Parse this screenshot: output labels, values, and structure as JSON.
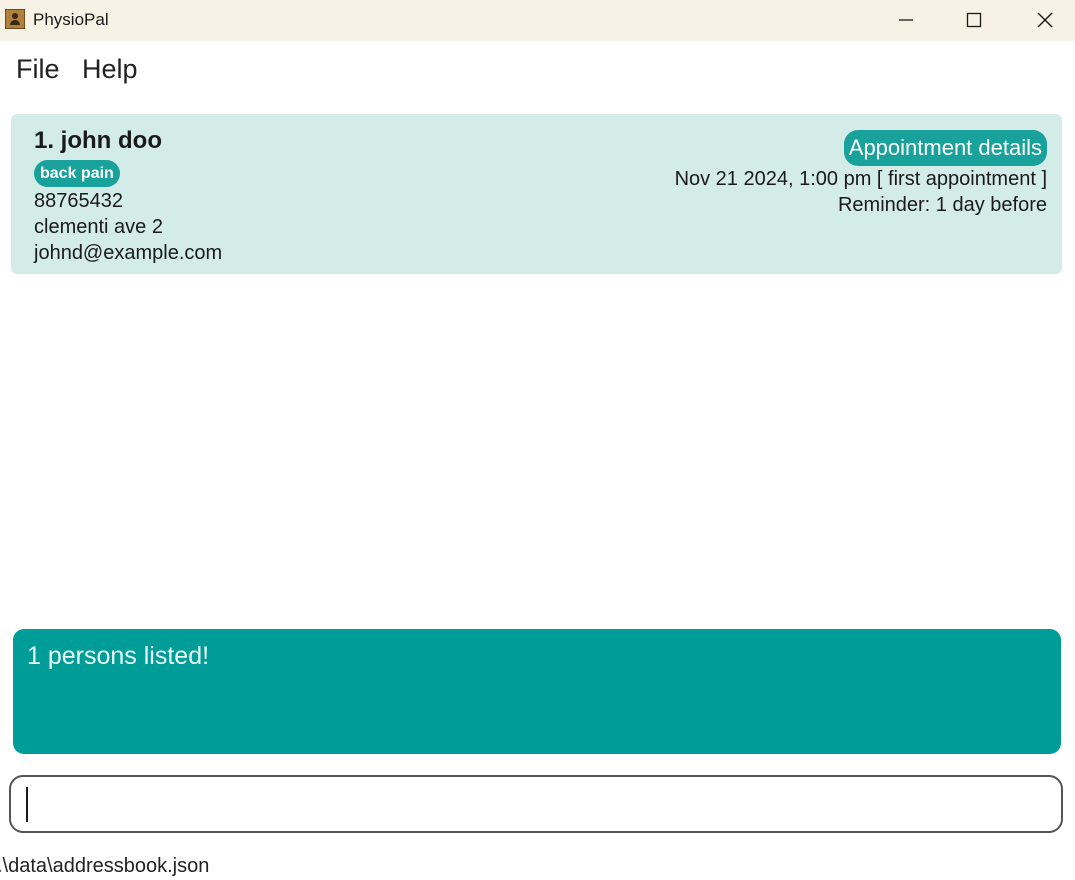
{
  "window": {
    "title": "PhysioPal",
    "icon": "address-book-icon"
  },
  "menu": {
    "items": [
      {
        "label": "File"
      },
      {
        "label": "Help"
      }
    ]
  },
  "persons": [
    {
      "name": "1. john doo",
      "tags": [
        "back pain"
      ],
      "phone": "88765432",
      "address": "clementi ave 2",
      "email": "johnd@example.com",
      "appointment_button": "Appointment details",
      "appointment": "Nov 21 2024, 1:00 pm [ first appointment ]",
      "reminder": "Reminder: 1 day before"
    }
  ],
  "result": {
    "message": "1 persons listed!"
  },
  "command": {
    "value": ""
  },
  "status": {
    "file_path": ".\\data\\addressbook.json"
  },
  "colors": {
    "titlebar": "#f7f1e6",
    "card": "#d3ece8",
    "accent": "#19a19c",
    "result_box": "#009c98"
  }
}
